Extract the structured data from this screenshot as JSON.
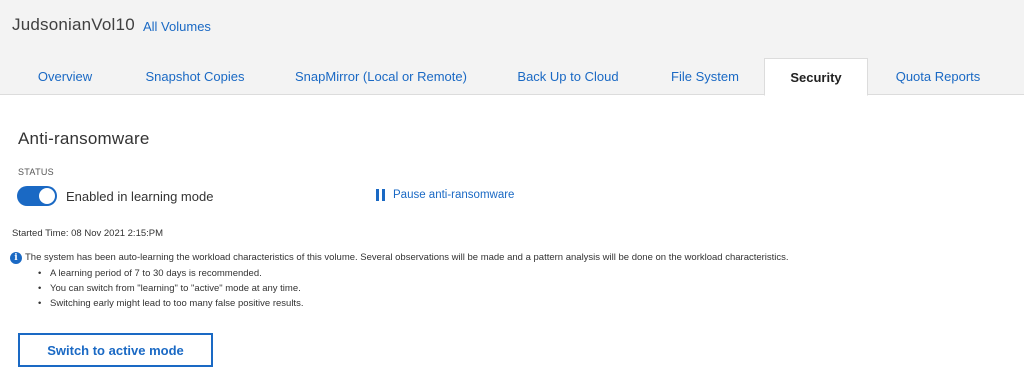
{
  "header": {
    "volume_name": "JudsonianVol10",
    "all_volumes_link": "All Volumes"
  },
  "tabs": [
    {
      "label": "Overview",
      "active": false
    },
    {
      "label": "Snapshot Copies",
      "active": false
    },
    {
      "label": "SnapMirror (Local or Remote)",
      "active": false
    },
    {
      "label": "Back Up to Cloud",
      "active": false
    },
    {
      "label": "File System",
      "active": false
    },
    {
      "label": "Security",
      "active": true
    },
    {
      "label": "Quota Reports",
      "active": false
    }
  ],
  "anti_ransomware": {
    "title": "Anti-ransomware",
    "status_label": "STATUS",
    "toggle_on": true,
    "toggle_label": "Enabled in learning mode",
    "pause_label": "Pause anti-ransomware",
    "started_time": "Started Time: 08 Nov 2021 2:15:PM",
    "info_text": "The system has been auto-learning the workload characteristics of this volume. Several observations will be made and a pattern analysis will be done on the workload characteristics.",
    "bullets": [
      "A learning period of 7 to 30 days is recommended.",
      "You can switch from \"learning\" to \"active\" mode at any time.",
      "Switching early might lead to too many false positive results."
    ],
    "switch_button": "Switch to active mode"
  },
  "colors": {
    "accent": "#1a69c4",
    "header_bg": "#f3f3f3"
  },
  "icons": {
    "pause": "pause-icon",
    "info": "info-icon"
  }
}
